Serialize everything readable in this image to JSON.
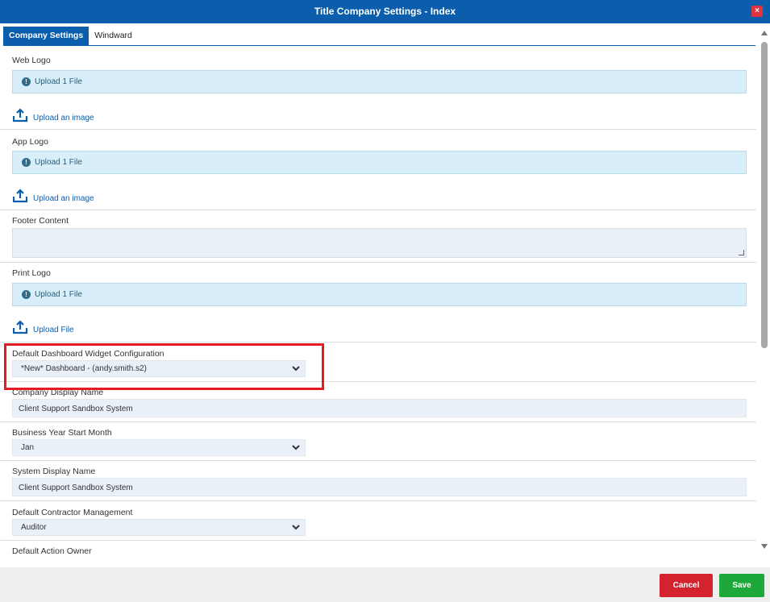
{
  "window": {
    "title": "Title Company Settings - Index",
    "close_label": "×"
  },
  "tabs": [
    {
      "label": "Company Settings",
      "active": true
    },
    {
      "label": "Windward",
      "active": false
    }
  ],
  "sections": {
    "web_logo": {
      "label": "Web Logo",
      "status": "Upload 1 File",
      "link": "Upload an image"
    },
    "app_logo": {
      "label": "App Logo",
      "status": "Upload 1 File",
      "link": "Upload an image"
    },
    "footer_content": {
      "label": "Footer Content",
      "value": ""
    },
    "print_logo": {
      "label": "Print Logo",
      "status": "Upload 1 File",
      "link": "Upload File"
    },
    "dashboard_widget": {
      "label": "Default Dashboard Widget Configuration",
      "value": "*New* Dashboard - (andy.smith.s2)"
    },
    "company_display_name": {
      "label": "Company Display Name",
      "value": "Client Support Sandbox System"
    },
    "business_year": {
      "label": "Business Year Start Month",
      "value": "Jan"
    },
    "system_display_name": {
      "label": "System Display Name",
      "value": "Client Support Sandbox System"
    },
    "contractor_mgmt": {
      "label": "Default Contractor Management",
      "value": "Auditor"
    },
    "action_owner": {
      "label": "Default Action Owner"
    }
  },
  "footer": {
    "cancel_label": "Cancel",
    "save_label": "Save"
  },
  "colors": {
    "header": "#0b5eab",
    "highlight": "#e31b23",
    "cancel": "#d4232f",
    "save": "#1ea83a"
  }
}
